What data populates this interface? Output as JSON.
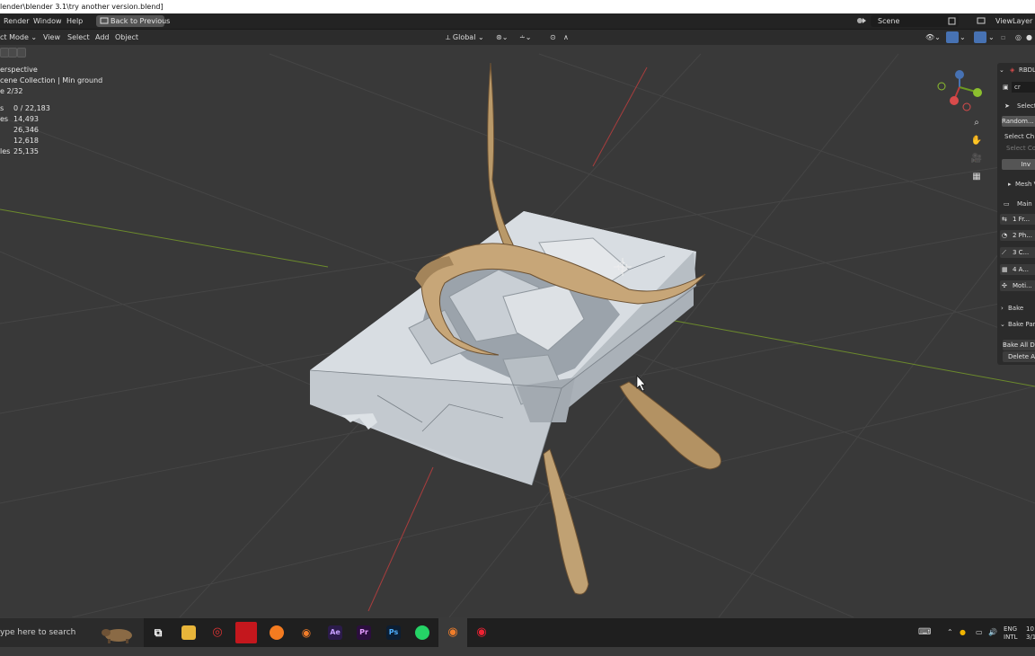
{
  "window": {
    "title": "lender\\blender 3.1\\try another version.blend]"
  },
  "menubar": {
    "items": [
      "Render",
      "Window",
      "Help"
    ],
    "back_button": "Back to Previous",
    "scene_label": "Scene",
    "viewlayer_label": "ViewLayer"
  },
  "header": {
    "mode": "ct Mode",
    "items": [
      "View",
      "Select",
      "Add",
      "Object"
    ],
    "transform_orientation": "Global"
  },
  "viewport_info": {
    "view_name": "erspective",
    "collection": "cene Collection | Min ground",
    "frame": "e 2/32",
    "stats": [
      {
        "key": "s",
        "value": "0 / 22,183"
      },
      {
        "key": "es",
        "value": "14,493"
      },
      {
        "key": "",
        "value": "26,346"
      },
      {
        "key": "",
        "value": "12,618"
      },
      {
        "key": "les",
        "value": "25,135"
      }
    ]
  },
  "sidepanel": {
    "header": "RBDL",
    "field": "cr",
    "select_label": "Select",
    "random_button": "Random...",
    "select_ch": "Select Ch",
    "select_co": "Select Co",
    "inv_button": "Inv",
    "mesh_label": "Mesh V",
    "main_label": "Main",
    "steps": [
      "1 Fr...",
      "2 Ph...",
      "3 C...",
      "4 A...",
      "Moti..."
    ],
    "bake_label": "Bake",
    "bake_part_label": "Bake Part",
    "bake_all_button": "Bake All D",
    "delete_button": "Delete A"
  },
  "taskbar": {
    "search_placeholder": "ype here to search",
    "apps": [
      "Ae",
      "Pr",
      "Ps"
    ],
    "lang": "ENG",
    "lang_sub": "INTL",
    "time": "10",
    "date": "3/1"
  },
  "colors": {
    "accent_blue": "#4772b3",
    "axis_red": "#a83d3d",
    "axis_green": "#6c8a2c"
  }
}
